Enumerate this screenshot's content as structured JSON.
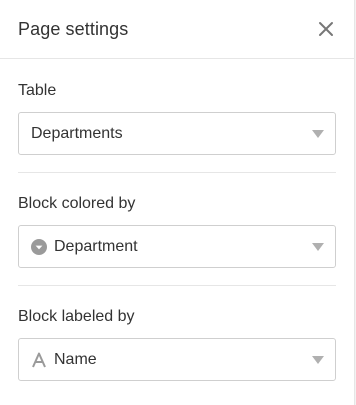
{
  "header": {
    "title": "Page settings"
  },
  "table": {
    "label": "Table",
    "value": "Departments"
  },
  "block_colored_by": {
    "label": "Block colored by",
    "value": "Department",
    "icon": "single-select-icon"
  },
  "block_labeled_by": {
    "label": "Block labeled by",
    "value": "Name",
    "icon": "text-column-icon"
  }
}
